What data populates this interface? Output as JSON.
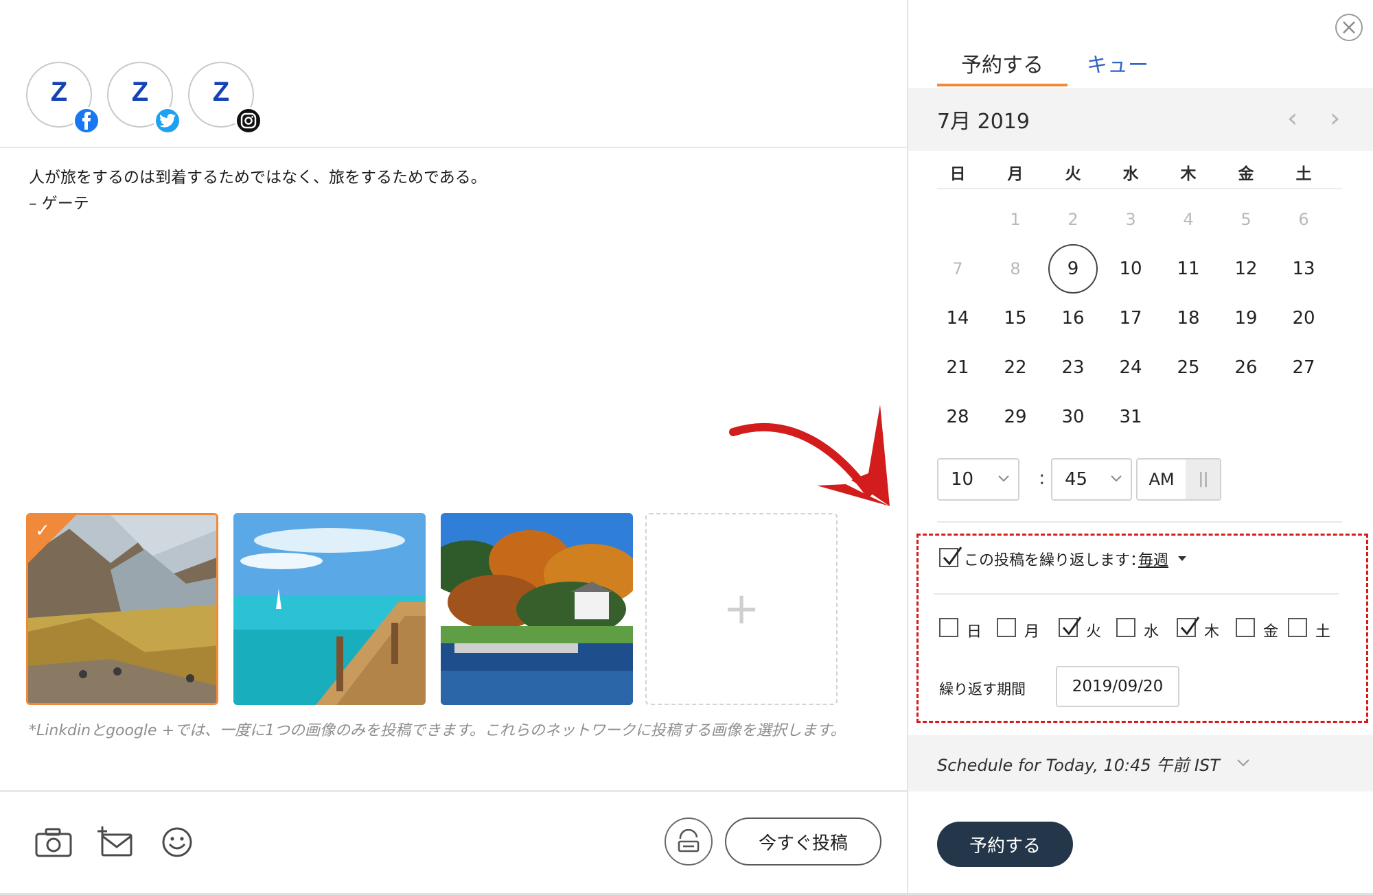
{
  "accounts": [
    {
      "logo": "Z",
      "network": "facebook-icon"
    },
    {
      "logo": "Z",
      "network": "twitter-icon"
    },
    {
      "logo": "Z",
      "network": "instagram-icon"
    }
  ],
  "message": {
    "line1": "人が旅をするのは到着するためではなく、旅をするためである。",
    "line2": "– ゲーテ"
  },
  "media": {
    "images": [
      {
        "name": "mountain-valley-image",
        "selected": true
      },
      {
        "name": "pier-sea-image",
        "selected": false
      },
      {
        "name": "autumn-island-image",
        "selected": false
      }
    ],
    "add_symbol": "+"
  },
  "note": "*Linkdinとgoogle +では、一度に1つの画像のみを投稿できます。これらのネットワークに投稿する画像を選択します。",
  "toolbar": {
    "icons": [
      "camera-icon",
      "add-mail-icon",
      "emoji-icon"
    ],
    "draft_icon": "save-draft-icon",
    "post_now_label": "今すぐ投稿"
  },
  "scheduler": {
    "tabs": {
      "schedule": "予約する",
      "queue": "キュー"
    },
    "month_label": "7月 2019",
    "prev_arrow": "‹",
    "next_arrow": "›",
    "weekdays": [
      "日",
      "月",
      "火",
      "水",
      "木",
      "金",
      "土"
    ],
    "weeks": [
      [
        "",
        "1",
        "2",
        "3",
        "4",
        "5",
        "6"
      ],
      [
        "7",
        "8",
        "9",
        "10",
        "11",
        "12",
        "13"
      ],
      [
        "14",
        "15",
        "16",
        "17",
        "18",
        "19",
        "20"
      ],
      [
        "21",
        "22",
        "23",
        "24",
        "25",
        "26",
        "27"
      ],
      [
        "28",
        "29",
        "30",
        "31",
        "",
        "",
        ""
      ]
    ],
    "today": "9",
    "time": {
      "hour": "10",
      "minute": "45",
      "colon": ":",
      "am": "AM",
      "pm": "||"
    },
    "repeat": {
      "checked": true,
      "label": "この投稿を繰り返します：",
      "frequency": "毎週",
      "days": [
        {
          "label": "日",
          "checked": false
        },
        {
          "label": "月",
          "checked": false
        },
        {
          "label": "火",
          "checked": true
        },
        {
          "label": "水",
          "checked": false
        },
        {
          "label": "木",
          "checked": true
        },
        {
          "label": "金",
          "checked": false
        },
        {
          "label": "土",
          "checked": false
        }
      ],
      "until_label": "繰り返す期間",
      "until_value": "2019/09/20"
    },
    "summary": "Schedule for Today, 10:45 午前 IST",
    "schedule_button": "予約する"
  },
  "colors": {
    "accent": "#f0893a",
    "link": "#2f63c6",
    "primary_button": "#243649",
    "annotation": "#d31c1c"
  }
}
